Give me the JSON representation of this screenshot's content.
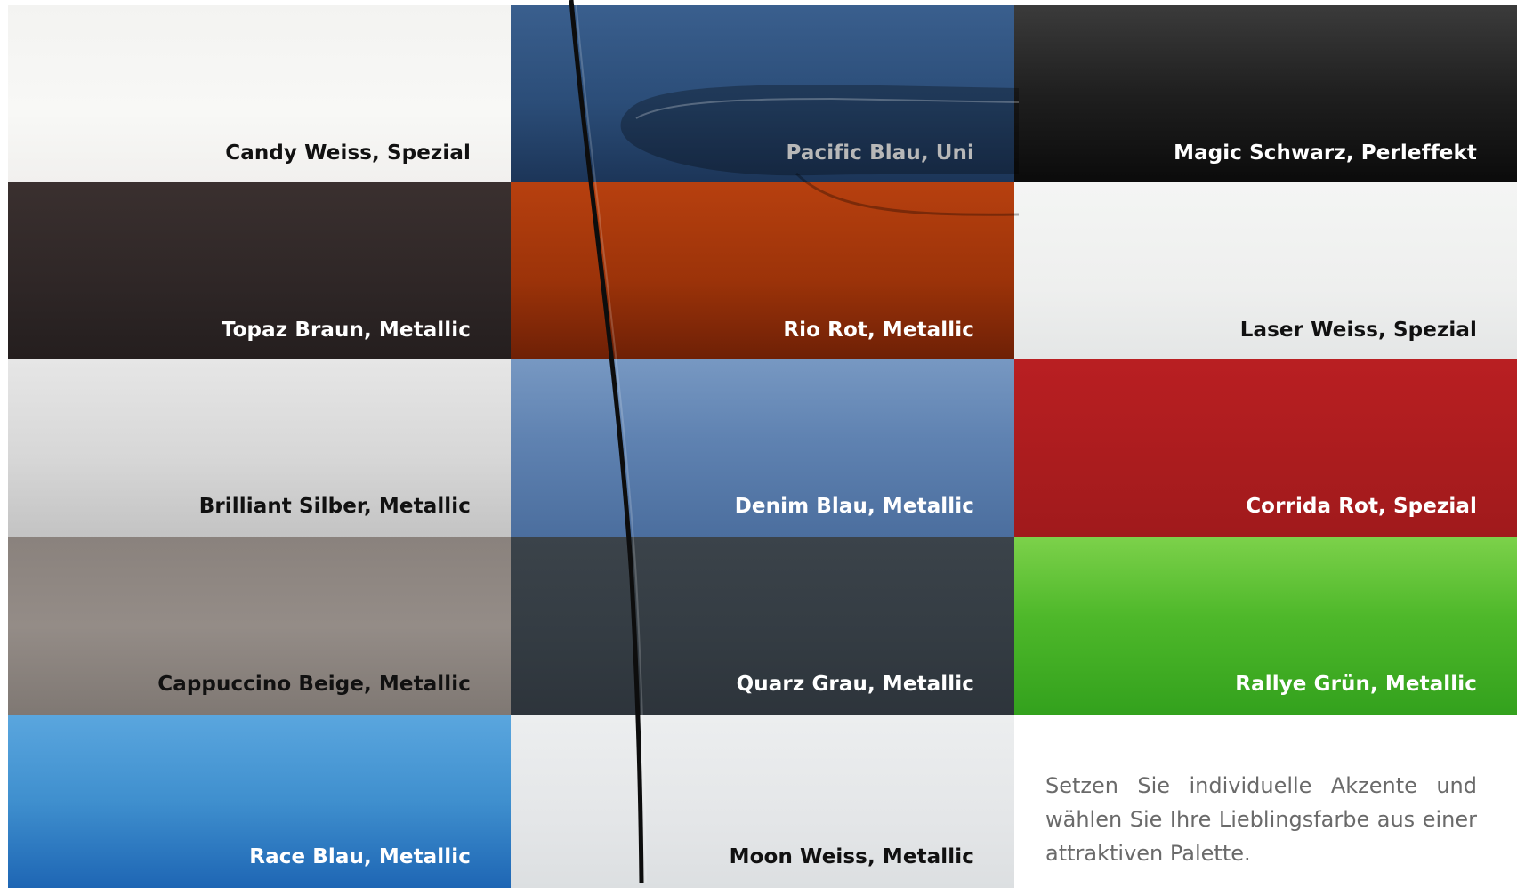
{
  "swatches": [
    {
      "name": "Candy Weiss, Spezial",
      "fill": "linear-gradient(180deg,#f3f3f1 0%,#f8f8f6 60%,#f1f0ee 100%)",
      "text": "dark",
      "col": 0,
      "row": 0
    },
    {
      "name": "Pacific Blau, Uni",
      "fill": "linear-gradient(180deg,#3a5f8e 0%,#2b4d78 55%,#1c3558 100%)",
      "text": "light",
      "col": 1,
      "row": 0
    },
    {
      "name": "Magic Schwarz, Perleffekt",
      "fill": "linear-gradient(180deg,#3b3b3b 0%,#1f1f1f 50%,#0b0b0b 100%)",
      "text": "light",
      "col": 2,
      "row": 0
    },
    {
      "name": "Topaz Braun, Metallic",
      "fill": "linear-gradient(180deg,#3a302f 0%,#2e2626 60%,#241e1e 100%)",
      "text": "light",
      "col": 0,
      "row": 1
    },
    {
      "name": "Rio Rot, Metallic",
      "fill": "linear-gradient(180deg,#b7400f 0%,#9c3309 55%,#6e2006 100%)",
      "text": "light",
      "col": 1,
      "row": 1
    },
    {
      "name": "Laser Weiss, Spezial",
      "fill": "linear-gradient(180deg,#f4f5f4 0%,#eeefee 60%,#e4e6e6 100%)",
      "text": "dark",
      "col": 2,
      "row": 1
    },
    {
      "name": "Brilliant Silber, Metallic",
      "fill": "linear-gradient(180deg,#e6e6e6 0%,#d7d7d7 55%,#c3c3c3 100%)",
      "text": "dark",
      "col": 0,
      "row": 2
    },
    {
      "name": "Denim Blau, Metallic",
      "fill": "linear-gradient(180deg,#7798c2 0%,#5f82b1 45%,#4b6e9e 100%)",
      "text": "light",
      "col": 1,
      "row": 2
    },
    {
      "name": "Corrida Rot, Spezial",
      "fill": "linear-gradient(180deg,#b91f22 0%,#aa1c1e 60%,#a01a1c 100%)",
      "text": "light",
      "col": 2,
      "row": 2
    },
    {
      "name": "Cappuccino Beige, Metallic",
      "fill": "linear-gradient(180deg,#8a827d 0%,#948c87 50%,#7f7873 100%)",
      "text": "dark",
      "col": 0,
      "row": 3
    },
    {
      "name": "Quarz Grau, Metallic",
      "fill": "linear-gradient(180deg,#3b434a 0%,#343c43 55%,#2d343b 100%)",
      "text": "light",
      "col": 1,
      "row": 3
    },
    {
      "name": "Rallye Grün, Metallic",
      "fill": "linear-gradient(180deg,#7cd14a 0%,#4eb82a 45%,#33a11d 100%)",
      "text": "light",
      "col": 2,
      "row": 3
    },
    {
      "name": "Race Blau, Metallic",
      "fill": "linear-gradient(180deg,#5aa6de 0%,#3f8fce 50%,#1e66b4 100%)",
      "text": "light",
      "col": 0,
      "row": 4
    },
    {
      "name": "Moon Weiss, Metallic",
      "fill": "linear-gradient(180deg,#eceeef 0%,#e4e6e8 60%,#dcdfe1 100%)",
      "text": "dark",
      "col": 1,
      "row": 4
    }
  ],
  "tagline": "Setzen Sie individuelle Akzente und wählen Sie Ihre Lieblingsfarbe aus einer attraktiven Palette."
}
